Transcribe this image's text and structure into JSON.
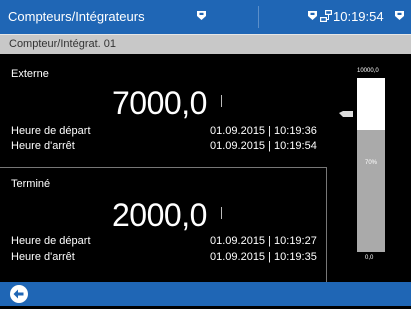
{
  "header": {
    "title": "Compteurs/Intégrateurs",
    "time": "10:19:54",
    "icons": [
      "flag-icon",
      "flag-icon",
      "network-icon",
      "flag-icon"
    ],
    "background_color": "#1f66b5"
  },
  "subheader": {
    "title": "Compteur/Intégrat. 01"
  },
  "panel_external": {
    "label": "Externe",
    "value": "7000,0",
    "start_label": "Heure de départ",
    "start_value": "01.09.2015 | 10:19:36",
    "stop_label": "Heure d'arrêt",
    "stop_value": "01.09.2015 | 10:19:54"
  },
  "panel_finished": {
    "label": "Terminé",
    "value": "2000,0",
    "start_label": "Heure de départ",
    "start_value": "01.09.2015 | 10:19:27",
    "stop_label": "Heure d'arrêt",
    "stop_value": "01.09.2015 | 10:19:35"
  },
  "bar_graph": {
    "max_label": "10000,0",
    "min_label": "0,0",
    "percent_label": "70%",
    "fill_fraction": 0.7,
    "fill_color": "#aaaaaa",
    "empty_color": "#ffffff"
  },
  "footer": {
    "back_icon": "back-arrow-icon"
  }
}
